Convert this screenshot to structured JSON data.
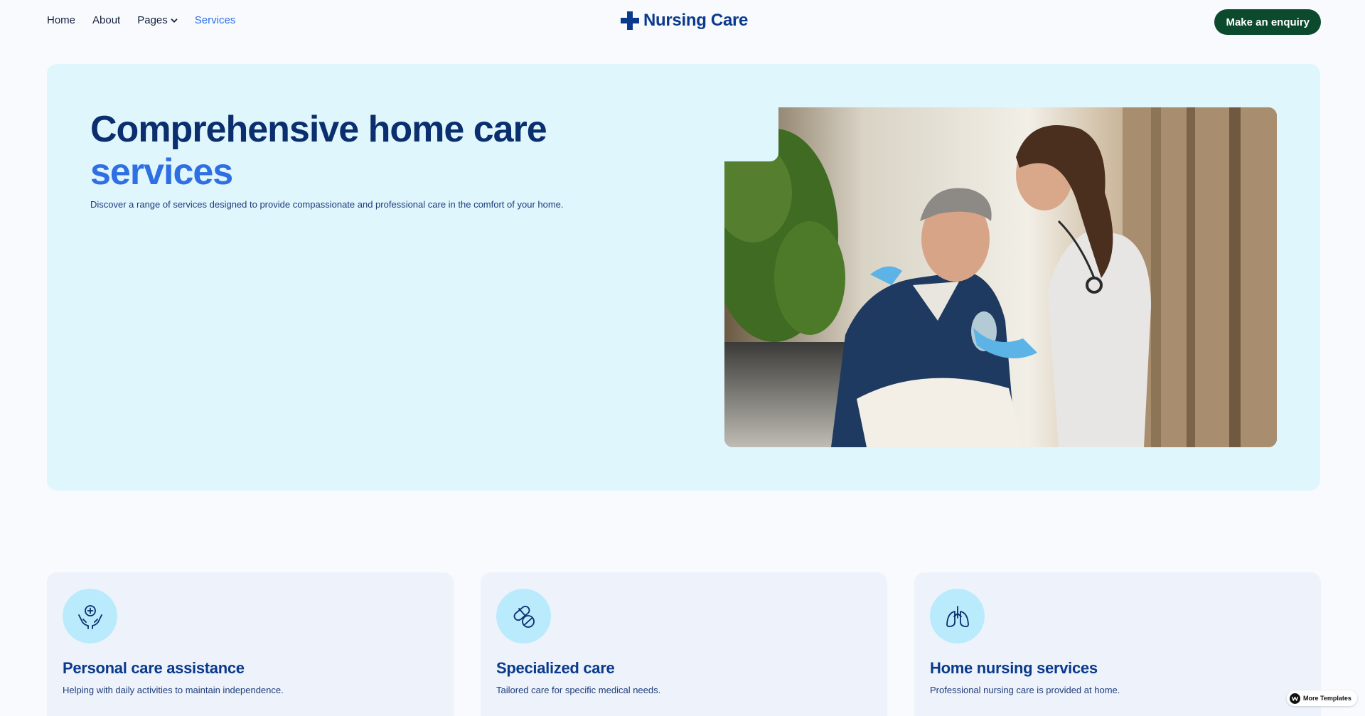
{
  "nav": {
    "links": [
      {
        "label": "Home"
      },
      {
        "label": "About"
      },
      {
        "label": "Pages"
      },
      {
        "label": "Services"
      }
    ],
    "brand": "Nursing Care",
    "cta": "Make an enquiry"
  },
  "hero": {
    "title_line1": "Comprehensive home care",
    "title_line2": "services",
    "subtitle": "Discover a range of services designed to provide compassionate and professional care in the comfort of your home."
  },
  "cards": [
    {
      "icon": "hands-care-icon",
      "title": "Personal care assistance",
      "text": "Helping with daily activities to maintain independence."
    },
    {
      "icon": "pills-icon",
      "title": "Specialized care",
      "text": "Tailored care for specific medical needs."
    },
    {
      "icon": "lungs-icon",
      "title": "Home nursing services",
      "text": "Professional nursing care is provided at home."
    }
  ],
  "badge": {
    "label": "More Templates"
  },
  "colors": {
    "accent": "#2f6fe4",
    "brand": "#0a3a8c",
    "cta": "#0b4a2c",
    "hero_bg": "#e0f6fd"
  }
}
